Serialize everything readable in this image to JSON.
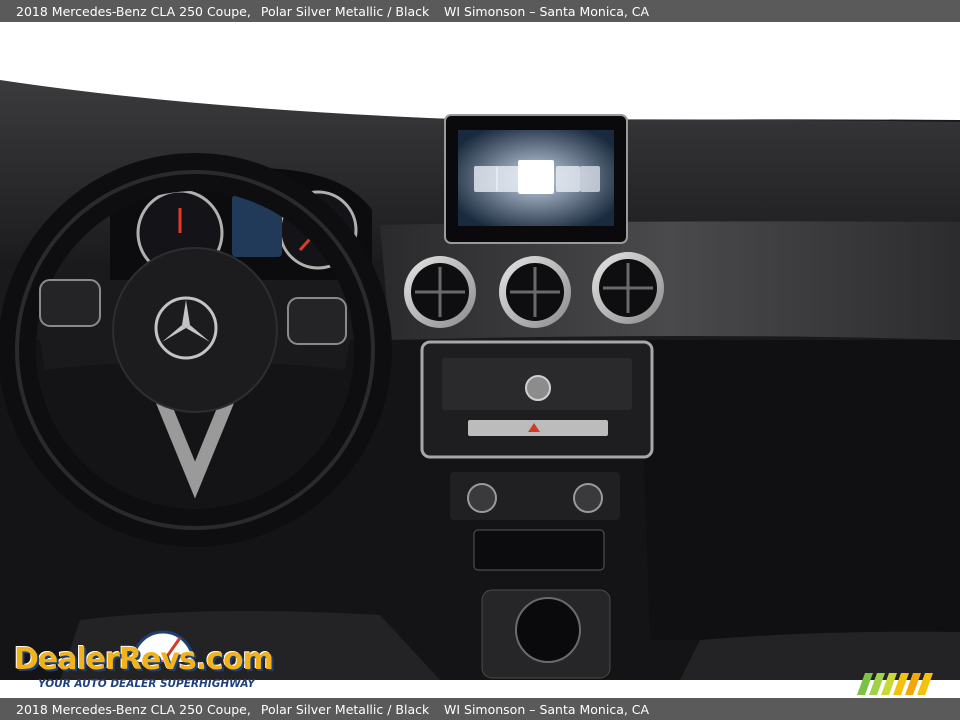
{
  "caption": {
    "title": "2018 Mercedes-Benz CLA 250 Coupe,",
    "color": "Polar Silver Metallic / Black",
    "dealer": "WI Simonson – Santa Monica, CA"
  },
  "watermark": {
    "logo_text": "DealerRevs.com",
    "tagline": "YOUR AUTO DEALER SUPERHIGHWAY"
  },
  "icons": [
    "mercedes-star-icon",
    "dealer-revs-gauge-icon",
    "stripes-logo-icon"
  ],
  "colors": {
    "caption_bar": "#5a5a5a",
    "dashboard": "#1a1a1c",
    "logo_gold": "#f2b21b",
    "logo_blue": "#1c3f7a",
    "stripe_green": "#7cc242",
    "stripe_yellow": "#f4c20d"
  }
}
